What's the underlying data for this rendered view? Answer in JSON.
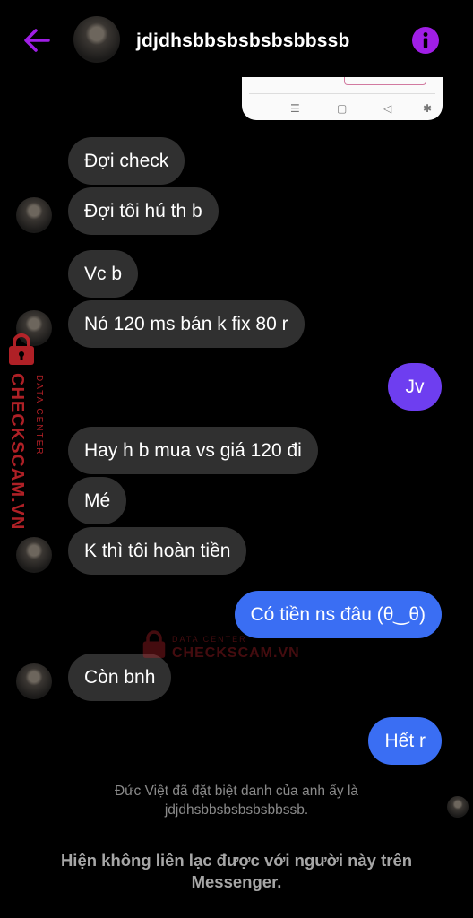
{
  "header": {
    "title": "jdjdhsbbsbsbsbsbbssb",
    "back_icon": "arrow-left-icon",
    "info_icon": "info-icon",
    "accent_color": "#a01ee6"
  },
  "messages": [
    {
      "text": "Đợi check"
    },
    {
      "text": "Đợi tôi hú th b"
    },
    {
      "text": "Vc b"
    },
    {
      "text": "Nó 120 ms bán k fix 80 r"
    },
    {
      "text": "Jv"
    },
    {
      "text": "Hay h b mua vs giá 120 đi"
    },
    {
      "text": "Mé"
    },
    {
      "text": "K thì tôi hoàn tiền"
    },
    {
      "text": "Có tiền ns đâu (θ‿θ)"
    },
    {
      "text": "Còn bnh"
    },
    {
      "text": "Hết r"
    }
  ],
  "system_note": "Đức Việt đã đặt biệt danh của anh ấy là jdjdhsbbsbsbsbsbbssb.",
  "footer": "Hiện không liên lạc được với người này trên Messenger.",
  "watermark": {
    "brand": "CHECKSCAM.VN",
    "subtitle": "DATA CENTER",
    "color": "#c3242b"
  },
  "colors": {
    "incoming_bubble": "#303030",
    "outgoing_bubble": "#3a6ef3",
    "outgoing_bubble_alt": "#6e3ef0"
  }
}
